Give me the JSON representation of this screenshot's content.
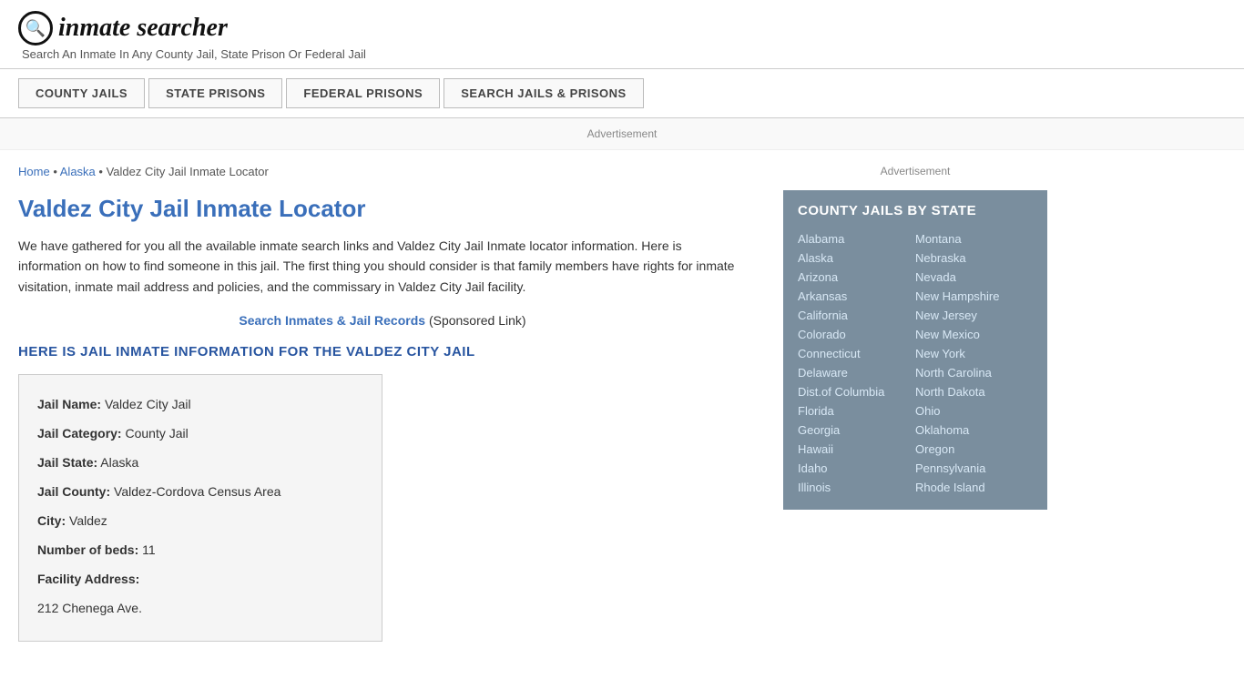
{
  "header": {
    "logo_icon": "🔍",
    "logo_text": "inmate searcher",
    "tagline": "Search An Inmate In Any County Jail, State Prison Or Federal Jail"
  },
  "nav": {
    "items": [
      {
        "label": "COUNTY JAILS",
        "id": "county-jails"
      },
      {
        "label": "STATE PRISONS",
        "id": "state-prisons"
      },
      {
        "label": "FEDERAL PRISONS",
        "id": "federal-prisons"
      },
      {
        "label": "SEARCH JAILS & PRISONS",
        "id": "search-jails"
      }
    ]
  },
  "ad_label": "Advertisement",
  "breadcrumb": {
    "home": "Home",
    "alaska": "Alaska",
    "current": "Valdez City Jail Inmate Locator"
  },
  "page_title": "Valdez City Jail Inmate Locator",
  "description": "We have gathered for you all the available inmate search links and Valdez City Jail Inmate locator information. Here is information on how to find someone in this jail. The first thing you should consider is that family members have rights for inmate visitation, inmate mail address and policies, and the commissary in Valdez City Jail facility.",
  "sponsored": {
    "link_text": "Search Inmates & Jail Records",
    "suffix": "(Sponsored Link)"
  },
  "section_heading": "HERE IS JAIL INMATE INFORMATION FOR THE VALDEZ CITY JAIL",
  "jail_info": {
    "name_label": "Jail Name:",
    "name_value": "Valdez City Jail",
    "category_label": "Jail Category:",
    "category_value": "County Jail",
    "state_label": "Jail State:",
    "state_value": "Alaska",
    "county_label": "Jail County:",
    "county_value": "Valdez-Cordova Census Area",
    "city_label": "City:",
    "city_value": "Valdez",
    "beds_label": "Number of beds:",
    "beds_value": "11",
    "address_label": "Facility Address:",
    "address_value": "212 Chenega Ave."
  },
  "sidebar": {
    "ad_label": "Advertisement",
    "county_jails_title": "COUNTY JAILS BY STATE",
    "states_col1": [
      "Alabama",
      "Alaska",
      "Arizona",
      "Arkansas",
      "California",
      "Colorado",
      "Connecticut",
      "Delaware",
      "Dist.of Columbia",
      "Florida",
      "Georgia",
      "Hawaii",
      "Idaho",
      "Illinois"
    ],
    "states_col2": [
      "Montana",
      "Nebraska",
      "Nevada",
      "New Hampshire",
      "New Jersey",
      "New Mexico",
      "New York",
      "North Carolina",
      "North Dakota",
      "Ohio",
      "Oklahoma",
      "Oregon",
      "Pennsylvania",
      "Rhode Island"
    ]
  }
}
